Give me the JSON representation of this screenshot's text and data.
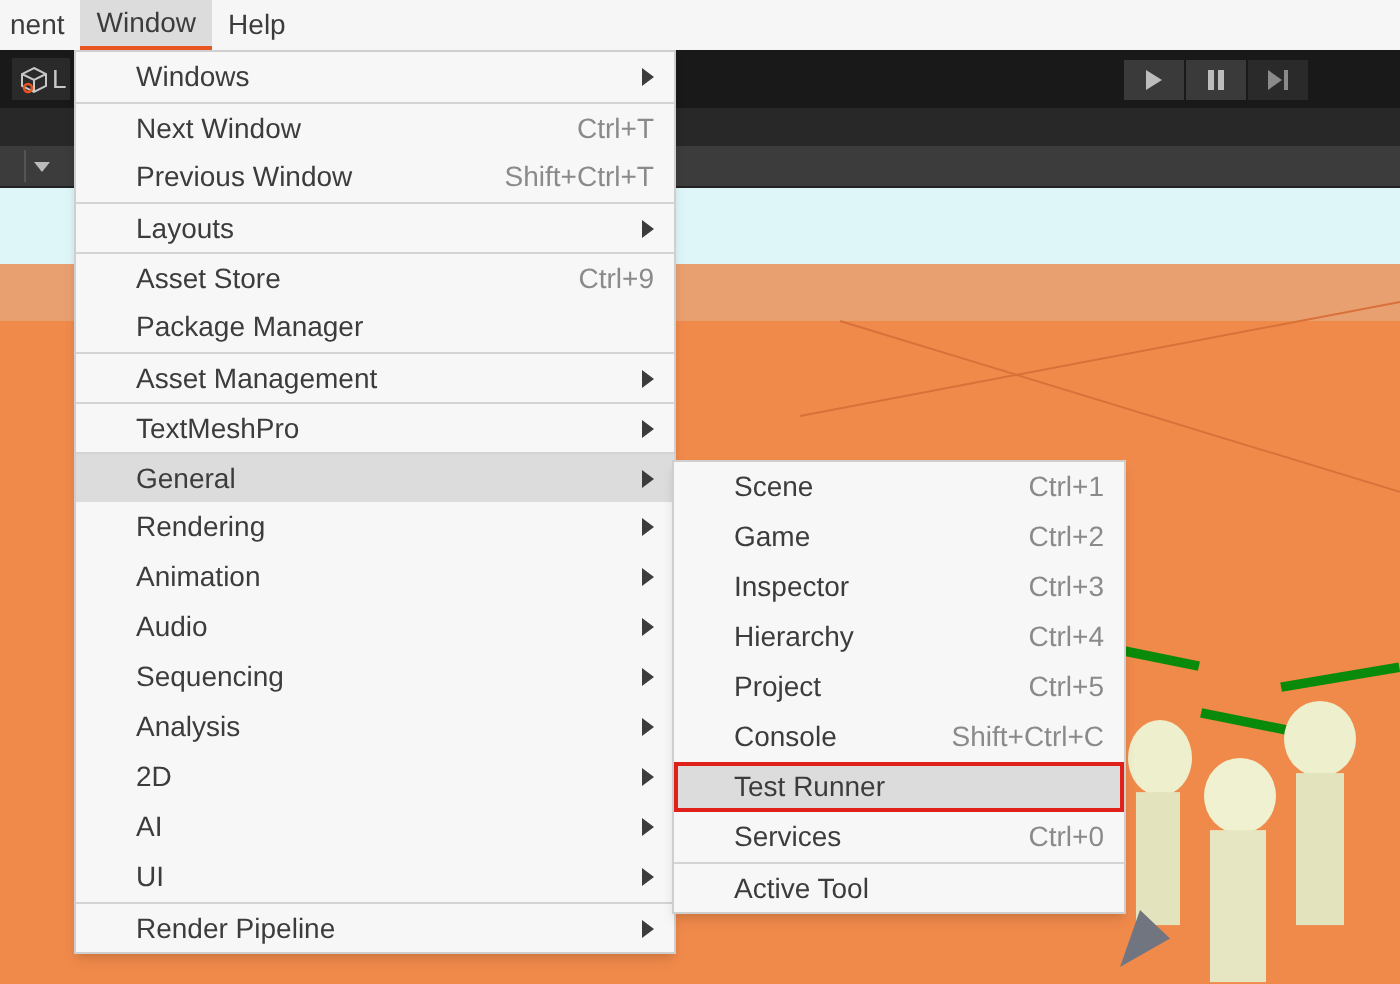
{
  "menubar": [
    {
      "label": "nent",
      "selected": false
    },
    {
      "label": "Window",
      "selected": true
    },
    {
      "label": "Help",
      "selected": false
    }
  ],
  "toolbar": {
    "scene_label": "L"
  },
  "menu": [
    {
      "label": "Windows",
      "submenu": true,
      "selected": false,
      "divider_above": false
    },
    {
      "label": "Next Window",
      "shortcut": "Ctrl+T",
      "submenu": false,
      "selected": false,
      "divider_above": true
    },
    {
      "label": "Previous Window",
      "shortcut": "Shift+Ctrl+T",
      "submenu": false,
      "selected": false,
      "divider_above": false
    },
    {
      "label": "Layouts",
      "submenu": true,
      "selected": false,
      "divider_above": true
    },
    {
      "label": "Asset Store",
      "shortcut": "Ctrl+9",
      "submenu": false,
      "selected": false,
      "divider_above": true
    },
    {
      "label": "Package Manager",
      "submenu": false,
      "selected": false,
      "divider_above": false
    },
    {
      "label": "Asset Management",
      "submenu": true,
      "selected": false,
      "divider_above": true
    },
    {
      "label": "TextMeshPro",
      "submenu": true,
      "selected": false,
      "divider_above": true
    },
    {
      "label": "General",
      "submenu": true,
      "selected": true,
      "divider_above": true
    },
    {
      "label": "Rendering",
      "submenu": true,
      "selected": false,
      "divider_above": false
    },
    {
      "label": "Animation",
      "submenu": true,
      "selected": false,
      "divider_above": false
    },
    {
      "label": "Audio",
      "submenu": true,
      "selected": false,
      "divider_above": false
    },
    {
      "label": "Sequencing",
      "submenu": true,
      "selected": false,
      "divider_above": false
    },
    {
      "label": "Analysis",
      "submenu": true,
      "selected": false,
      "divider_above": false
    },
    {
      "label": "2D",
      "submenu": true,
      "selected": false,
      "divider_above": false
    },
    {
      "label": "AI",
      "submenu": true,
      "selected": false,
      "divider_above": false
    },
    {
      "label": "UI",
      "submenu": true,
      "selected": false,
      "divider_above": false
    },
    {
      "label": "Render Pipeline",
      "submenu": true,
      "selected": false,
      "divider_above": true
    }
  ],
  "submenu": [
    {
      "label": "Scene",
      "shortcut": "Ctrl+1",
      "selected": false,
      "outlined": false,
      "divider_above": false
    },
    {
      "label": "Game",
      "shortcut": "Ctrl+2",
      "selected": false,
      "outlined": false,
      "divider_above": false
    },
    {
      "label": "Inspector",
      "shortcut": "Ctrl+3",
      "selected": false,
      "outlined": false,
      "divider_above": false
    },
    {
      "label": "Hierarchy",
      "shortcut": "Ctrl+4",
      "selected": false,
      "outlined": false,
      "divider_above": false
    },
    {
      "label": "Project",
      "shortcut": "Ctrl+5",
      "selected": false,
      "outlined": false,
      "divider_above": false
    },
    {
      "label": "Console",
      "shortcut": "Shift+Ctrl+C",
      "selected": false,
      "outlined": false,
      "divider_above": false
    },
    {
      "label": "Test Runner",
      "selected": true,
      "outlined": true,
      "divider_above": false
    },
    {
      "label": "Services",
      "shortcut": "Ctrl+0",
      "selected": false,
      "outlined": false,
      "divider_above": false
    },
    {
      "label": "Active Tool",
      "selected": false,
      "outlined": false,
      "divider_above": true
    }
  ]
}
